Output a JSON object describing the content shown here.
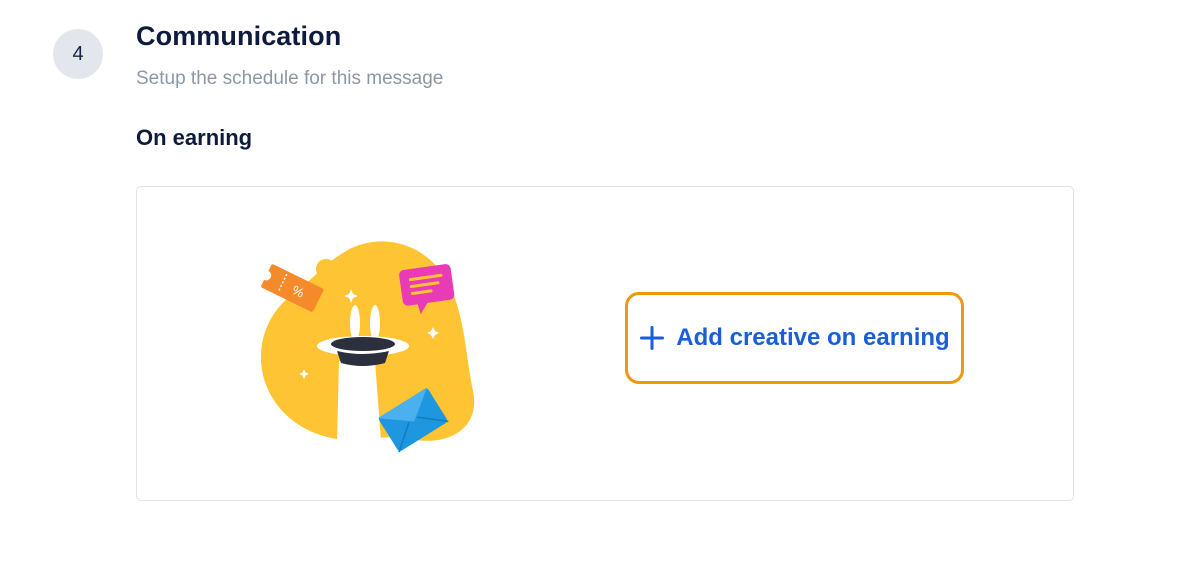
{
  "step": {
    "number": "4",
    "title": "Communication",
    "subtitle": "Setup the schedule for this message"
  },
  "section": {
    "title": "On earning"
  },
  "card": {
    "illustration": "magic-hat-rewards-illustration",
    "add_button_label": "Add creative on earning",
    "add_button_icon": "plus-icon"
  },
  "colors": {
    "accent_blue": "#1a5fd9",
    "highlight_orange": "#f2960c",
    "blob_yellow": "#fec433"
  }
}
